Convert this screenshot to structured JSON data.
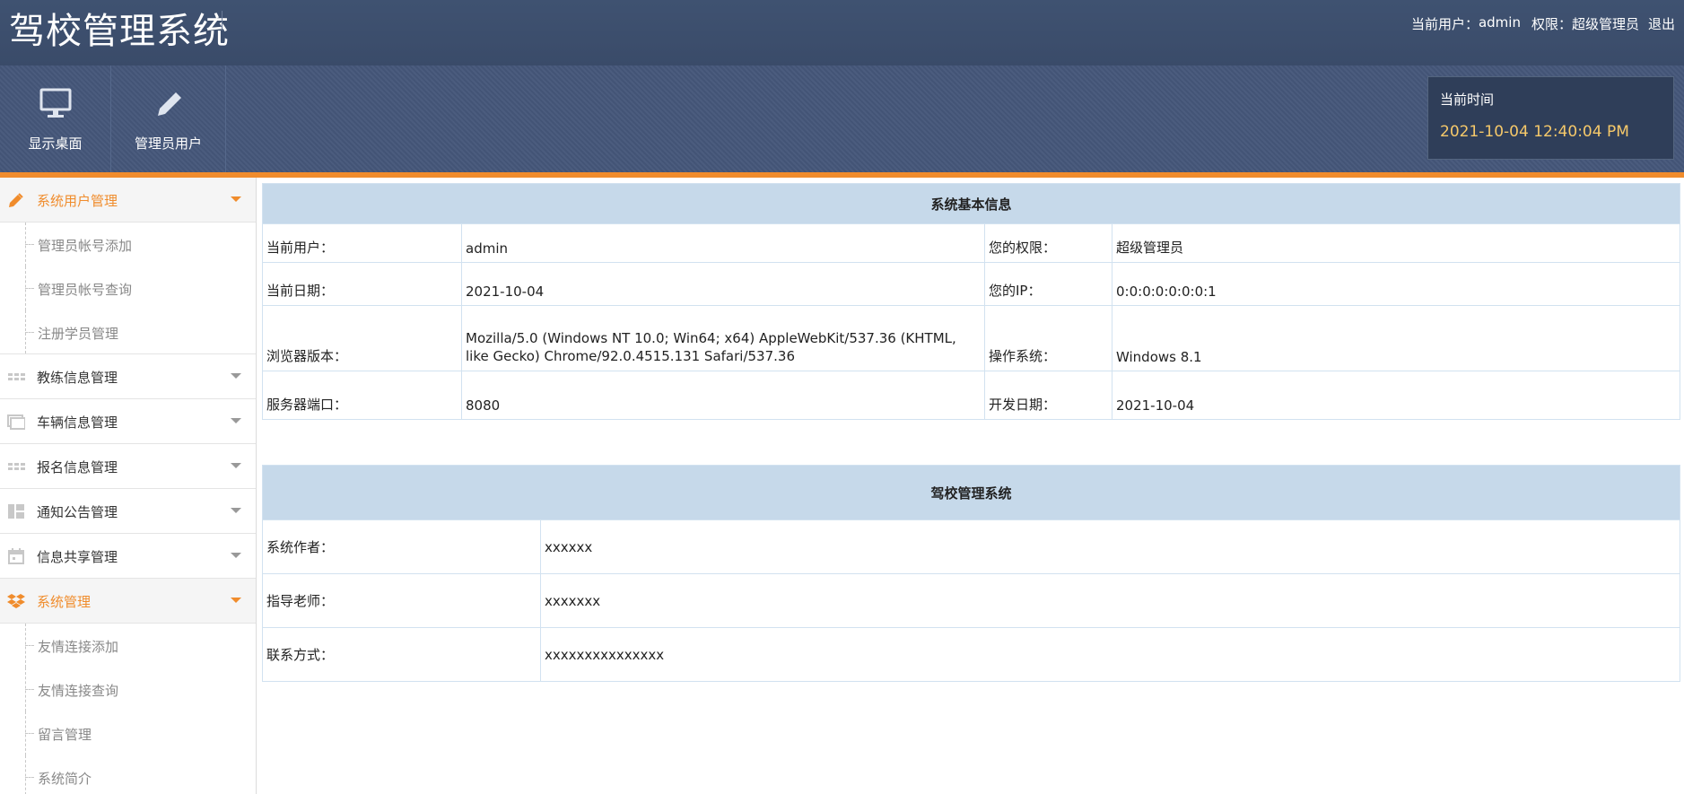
{
  "header": {
    "app_title": "驾校管理系统",
    "current_user_label": "当前用户：",
    "current_user": "admin",
    "role_label": "权限：",
    "role": "超级管理员",
    "logout": "退出"
  },
  "nav": {
    "desktop": {
      "label": "显示桌面",
      "icon": "monitor-icon"
    },
    "admin_user": {
      "label": "管理员用户",
      "icon": "pencil-icon"
    }
  },
  "clock": {
    "label": "当前时间",
    "value": "2021-10-04 12:40:04 PM"
  },
  "colors": {
    "header_bg": "#3e5070",
    "nav_bg": "#45577a",
    "accent": "#f08c2c",
    "clock_text": "#f6c96a",
    "table_head_bg": "#c6d9ea"
  },
  "sidebar": {
    "menus": [
      {
        "label": "系统用户管理",
        "icon": "pencil-icon",
        "expanded": true,
        "items": [
          "管理员帐号添加",
          "管理员帐号查询",
          "注册学员管理"
        ]
      },
      {
        "label": "教练信息管理",
        "icon": "grid-icon",
        "expanded": false,
        "items": []
      },
      {
        "label": "车辆信息管理",
        "icon": "image-icon",
        "expanded": false,
        "items": []
      },
      {
        "label": "报名信息管理",
        "icon": "grid-icon",
        "expanded": false,
        "items": []
      },
      {
        "label": "通知公告管理",
        "icon": "layout-icon",
        "expanded": false,
        "items": []
      },
      {
        "label": "信息共享管理",
        "icon": "calendar-icon",
        "expanded": false,
        "items": []
      },
      {
        "label": "系统管理",
        "icon": "dropbox-icon",
        "expanded": true,
        "items": [
          "友情连接添加",
          "友情连接查询",
          "留言管理",
          "系统简介"
        ]
      }
    ]
  },
  "system_info": {
    "title": "系统基本信息",
    "rows": [
      {
        "k1": "当前用户：",
        "v1": "admin",
        "k2": "您的权限：",
        "v2": "超级管理员"
      },
      {
        "k1": "当前日期：",
        "v1": "2021-10-04",
        "k2": "您的IP：",
        "v2": "0:0:0:0:0:0:0:1"
      },
      {
        "k1": "浏览器版本：",
        "v1": "Mozilla/5.0 (Windows NT 10.0; Win64; x64) AppleWebKit/537.36 (KHTML, like Gecko) Chrome/92.0.4515.131 Safari/537.36",
        "k2": "操作系统：",
        "v2": "Windows 8.1"
      },
      {
        "k1": "服务器端口：",
        "v1": "8080",
        "k2": "开发日期：",
        "v2": "2021-10-04"
      }
    ]
  },
  "about": {
    "title": "驾校管理系统",
    "rows": [
      {
        "k": "系统作者：",
        "v": "xxxxxx"
      },
      {
        "k": "指导老师：",
        "v": "xxxxxxx"
      },
      {
        "k": "联系方式：",
        "v": "xxxxxxxxxxxxxxx"
      }
    ]
  }
}
